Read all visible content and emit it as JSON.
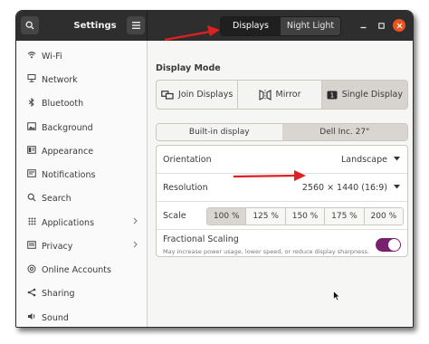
{
  "header": {
    "title": "Settings",
    "tabs": [
      {
        "label": "Displays",
        "active": true
      },
      {
        "label": "Night Light",
        "active": false
      }
    ]
  },
  "sidebar": {
    "items": [
      {
        "label": "Wi-Fi",
        "icon": "wifi-icon",
        "chevron": false
      },
      {
        "label": "Network",
        "icon": "network-icon",
        "chevron": false
      },
      {
        "label": "Bluetooth",
        "icon": "bluetooth-icon",
        "chevron": false
      },
      {
        "label": "Background",
        "icon": "background-icon",
        "chevron": false
      },
      {
        "label": "Appearance",
        "icon": "appearance-icon",
        "chevron": false
      },
      {
        "label": "Notifications",
        "icon": "notifications-icon",
        "chevron": false
      },
      {
        "label": "Search",
        "icon": "search-icon",
        "chevron": false
      },
      {
        "label": "Applications",
        "icon": "applications-icon",
        "chevron": true
      },
      {
        "label": "Privacy",
        "icon": "privacy-icon",
        "chevron": true
      },
      {
        "label": "Online Accounts",
        "icon": "online-accounts-icon",
        "chevron": false
      },
      {
        "label": "Sharing",
        "icon": "sharing-icon",
        "chevron": false
      },
      {
        "label": "Sound",
        "icon": "sound-icon",
        "chevron": false
      }
    ]
  },
  "display_mode": {
    "title": "Display Mode",
    "options": [
      {
        "label": "Join Displays",
        "selected": false
      },
      {
        "label": "Mirror",
        "selected": false
      },
      {
        "label": "Single Display",
        "selected": true
      }
    ]
  },
  "display_tabs": [
    {
      "label": "Built-in display",
      "selected": false
    },
    {
      "label": "Dell Inc. 27\"",
      "selected": true
    }
  ],
  "settings": {
    "orientation": {
      "label": "Orientation",
      "value": "Landscape"
    },
    "resolution": {
      "label": "Resolution",
      "value": "2560 × 1440 (16:9)"
    },
    "scale": {
      "label": "Scale",
      "options": [
        "100 %",
        "125 %",
        "150 %",
        "175 %",
        "200 %"
      ],
      "selected_index": 0
    },
    "fractional_scaling": {
      "label": "Fractional Scaling",
      "description": "May increase power usage, lower speed, or reduce display sharpness.",
      "enabled": true
    }
  },
  "colors": {
    "accent": "#77216f",
    "close_button": "#e95420",
    "annotation_arrow": "#e02020",
    "headerbar": "#2e2e2e"
  }
}
